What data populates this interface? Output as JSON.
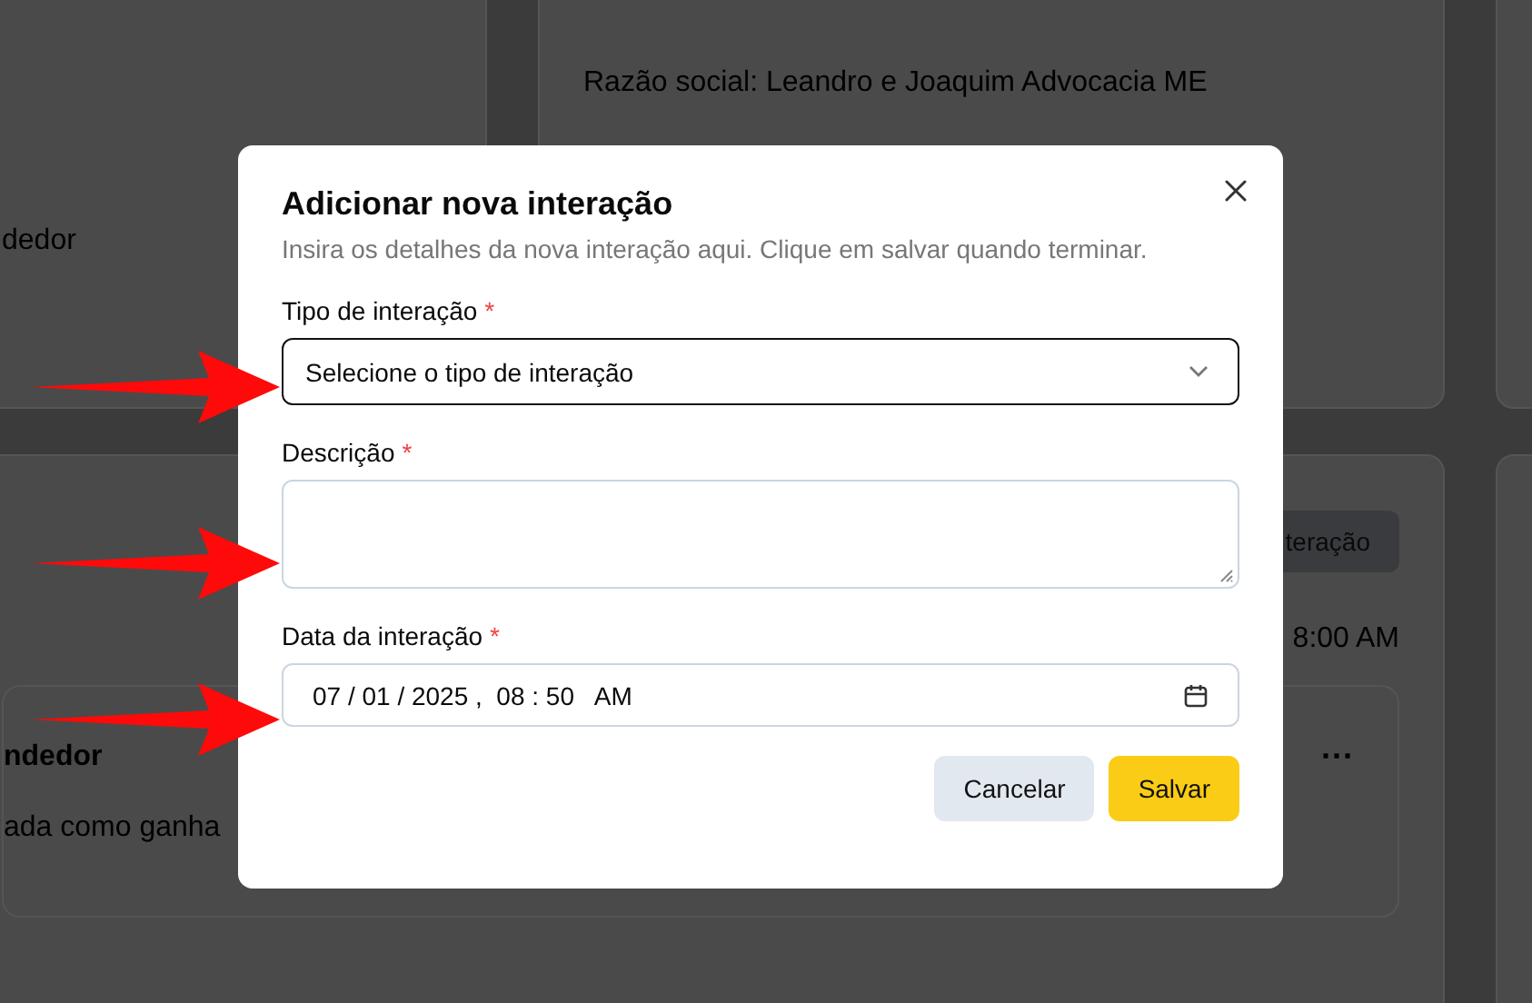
{
  "background": {
    "left_card": {
      "text": "dedor"
    },
    "company_card": {
      "text": "Razão social: Leandro e Joaquim Advocacia ME"
    },
    "interactions": {
      "button": "teração",
      "time": "8:00 AM",
      "item": {
        "title": "ndedor",
        "text": "ada como ganha",
        "menu": "···"
      }
    }
  },
  "dialog": {
    "title": "Adicionar nova interação",
    "description": "Insira os detalhes da nova interação aqui. Clique em salvar quando terminar.",
    "fields": [
      {
        "kind": "select",
        "label": "Tipo de interação",
        "required_mark": "*",
        "placeholder": "Selecione o tipo de interação",
        "focused": true
      },
      {
        "kind": "textarea",
        "label": "Descrição",
        "required_mark": "*",
        "focused": false
      },
      {
        "kind": "datetime",
        "label": "Data da interação",
        "required_mark": "*",
        "value": "07 / 01 / 2025 ,  08 : 50   AM",
        "focused": false
      }
    ],
    "buttons": [
      {
        "label": "Cancelar",
        "kind": "secondary"
      },
      {
        "label": "Salvar",
        "kind": "primary"
      }
    ]
  }
}
